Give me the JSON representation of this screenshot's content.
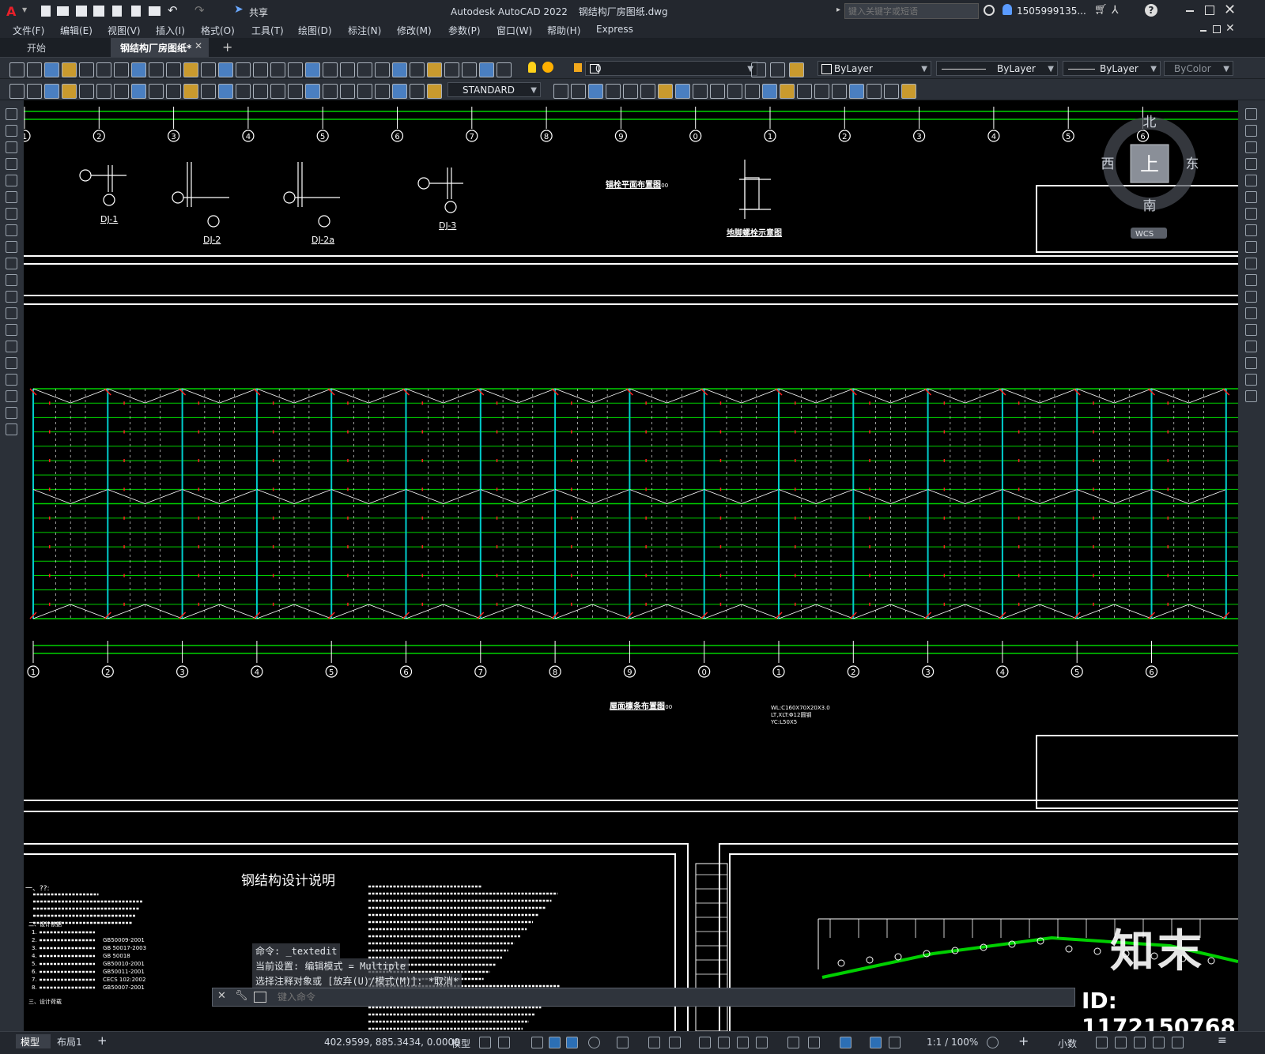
{
  "title_bar": {
    "app_title": "Autodesk AutoCAD 2022",
    "file_name": "钢结构厂房图纸.dwg",
    "share_label": "共享",
    "search_placeholder": "键入关键字或短语",
    "user_name": "1505999135..."
  },
  "menu": [
    "文件(F)",
    "编辑(E)",
    "视图(V)",
    "插入(I)",
    "格式(O)",
    "工具(T)",
    "绘图(D)",
    "标注(N)",
    "修改(M)",
    "参数(P)",
    "窗口(W)",
    "帮助(H)",
    "Express"
  ],
  "tabs": {
    "start": "开始",
    "active": "钢结构厂房图纸*"
  },
  "toolbar": {
    "layer_value": "0",
    "text_style": "STANDARD",
    "color": "ByLayer",
    "linetype": "ByLayer",
    "lineweight": "ByLayer",
    "plotstyle": "ByColor"
  },
  "viewcube": {
    "north": "北",
    "south": "南",
    "east": "东",
    "west": "西",
    "top": "上",
    "wcs": "WCS"
  },
  "drawing": {
    "axis_labels": [
      "1",
      "2",
      "3",
      "4",
      "5",
      "6",
      "7",
      "8",
      "9",
      "0",
      "1",
      "2",
      "3",
      "4",
      "5",
      "6"
    ],
    "foundation_labels": [
      "DJ-1",
      "DJ-2",
      "DJ-2a",
      "DJ-3"
    ],
    "anchor_plan_title": "锚栓平面布置图",
    "anchor_plan_scale": "1:100",
    "anchor_detail_title": "地脚螺栓示意图",
    "roof_purlin_title": "屋面檩条布置图",
    "roof_purlin_scale": "1:100",
    "member_notes": [
      "WL:C160X70X20X3.0",
      "LT,XLT:Φ12圆钢",
      "YC:L50X5"
    ],
    "design_notes_title": "钢结构设计说明",
    "notes_left_header": "一、??:",
    "design_basis_header": "二、设计依据",
    "standards": [
      {
        "no": "1.",
        "code": ""
      },
      {
        "no": "2.",
        "code": "GB50009-2001"
      },
      {
        "no": "3.",
        "code": "GB 50017-2003"
      },
      {
        "no": "4.",
        "code": "GB 50018"
      },
      {
        "no": "5.",
        "code": "GB50010-2001"
      },
      {
        "no": "6.",
        "code": "GB50011-2001"
      },
      {
        "no": "7.",
        "code": "CECS 102:2002"
      },
      {
        "no": "8.",
        "code": "GB50007-2001"
      }
    ],
    "notes_left_footer": "三、设计荷载"
  },
  "command": {
    "history_1": "命令: _textedit",
    "history_2": "当前设置: 编辑模式 = Multiple",
    "history_3": "选择注释对象或 [放弃(U)/模式(M)]: *取消*",
    "input_placeholder": "键入命令"
  },
  "status": {
    "layout_model": "模型",
    "layout_1": "布局1",
    "coordinates": "402.9599, 885.3434, 0.0000",
    "model_label": "模型",
    "scale": "1:1 / 100%",
    "units": "小数"
  },
  "watermark": {
    "brand": "知末",
    "id": "ID: 1172150768"
  },
  "colors": {
    "grid_green": "#00d000",
    "frame_cyan": "#00cccc",
    "mark_red": "#ff2020",
    "line_white": "#ffffff"
  }
}
